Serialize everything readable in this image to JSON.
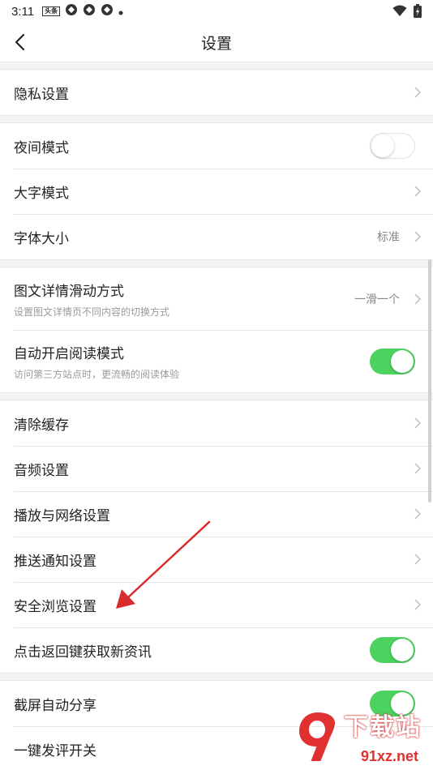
{
  "status_bar": {
    "time": "3:11",
    "badge": "头条"
  },
  "header": {
    "title": "设置"
  },
  "settings": {
    "privacy": {
      "label": "隐私设置"
    },
    "night_mode": {
      "label": "夜间模式",
      "enabled": false
    },
    "large_font": {
      "label": "大字模式"
    },
    "font_size": {
      "label": "字体大小",
      "value": "标准"
    },
    "slide_mode": {
      "label": "图文详情滑动方式",
      "sub": "设置图文详情页不同内容的切换方式",
      "value": "一滑一个"
    },
    "auto_read": {
      "label": "自动开启阅读模式",
      "sub": "访问第三方站点时，更流畅的阅读体验",
      "enabled": true
    },
    "clear_cache": {
      "label": "清除缓存"
    },
    "audio": {
      "label": "音频设置"
    },
    "playback_network": {
      "label": "播放与网络设置"
    },
    "push": {
      "label": "推送通知设置"
    },
    "safe_browsing": {
      "label": "安全浏览设置"
    },
    "back_refresh": {
      "label": "点击返回键获取新资讯",
      "enabled": true
    },
    "screenshot_share": {
      "label": "截屏自动分享",
      "enabled": true
    },
    "one_tap_comment": {
      "label": "一键发评开关"
    }
  },
  "watermark": {
    "top": "下载站",
    "bottom": "91xz.net"
  },
  "colors": {
    "toggle_on": "#4cd25e",
    "annotation_arrow": "#d92b2b"
  }
}
